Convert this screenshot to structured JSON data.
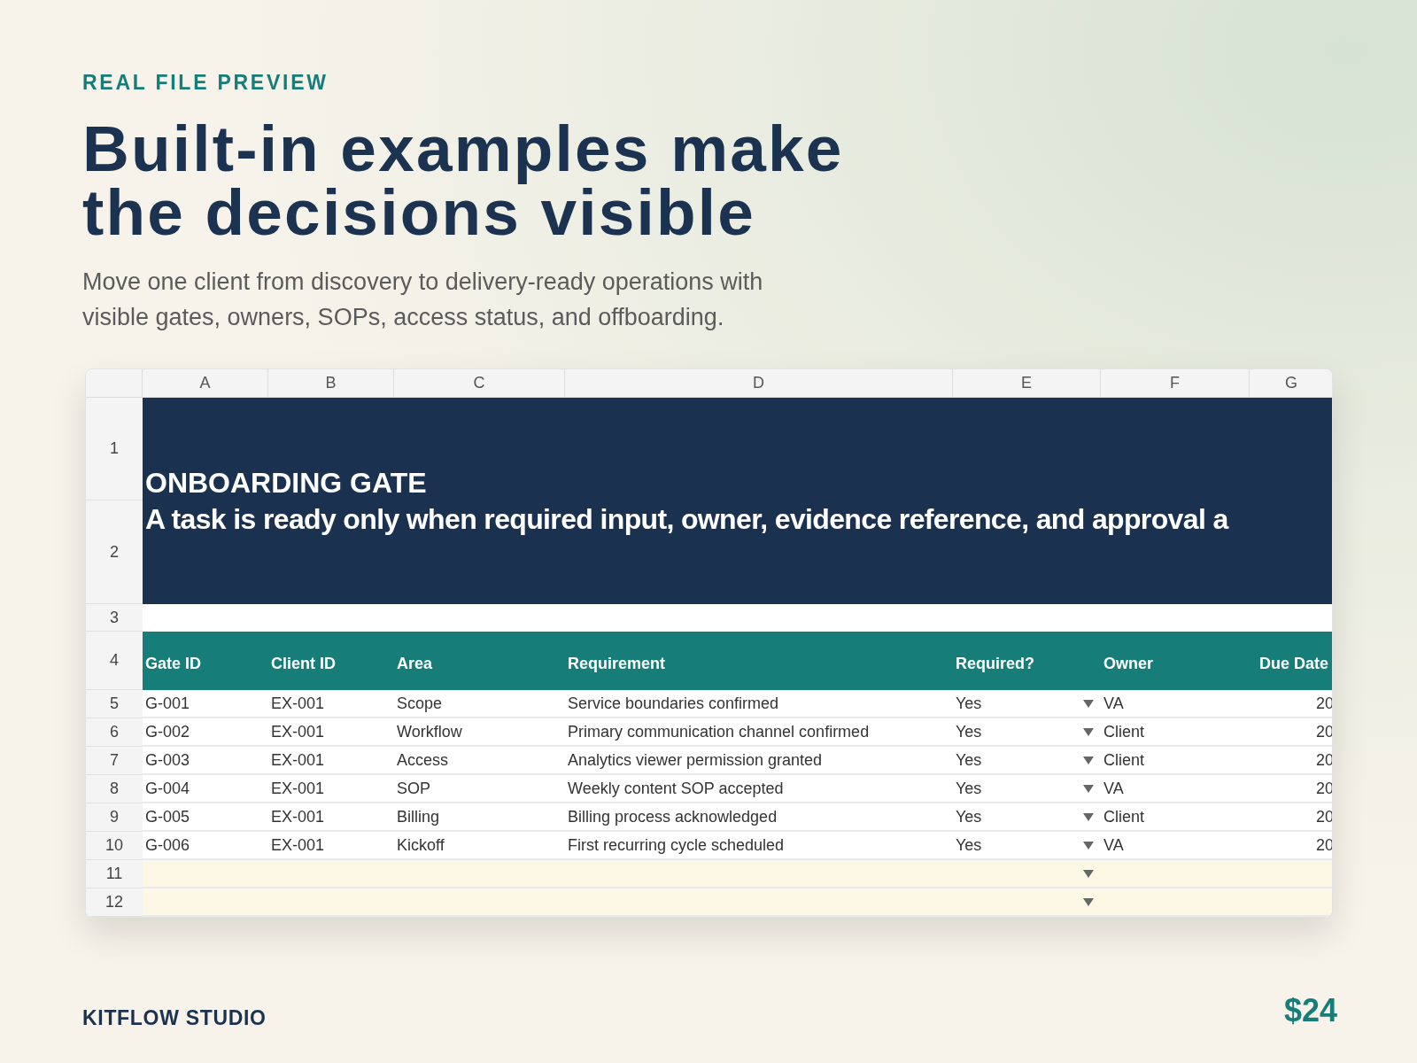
{
  "eyebrow": "REAL FILE PREVIEW",
  "headline_lines": [
    "Built-in examples make",
    "the decisions visible"
  ],
  "subtitle": "Move one client from discovery to delivery-ready operations with visible gates, owners, SOPs, access status, and offboarding.",
  "sheet": {
    "column_letters": [
      "A",
      "B",
      "C",
      "D",
      "E",
      "F",
      "G"
    ],
    "banner_title": "ONBOARDING GATE",
    "banner_subtitle": "A task is ready only when required input, owner, evidence reference, and approval a",
    "columns": [
      "Gate ID",
      "Client ID",
      "Area",
      "Requirement",
      "Required?",
      "Owner",
      "Due Date"
    ],
    "rows": [
      {
        "number": "1",
        "kind": "banner"
      },
      {
        "number": "2",
        "kind": "banner"
      },
      {
        "number": "3",
        "kind": "spacer"
      },
      {
        "number": "4",
        "kind": "header"
      },
      {
        "number": "5",
        "kind": "data",
        "cells": [
          "G-001",
          "EX-001",
          "Scope",
          "Service boundaries confirmed",
          "Yes",
          "VA",
          "20"
        ],
        "dropdown": true
      },
      {
        "number": "6",
        "kind": "data",
        "cells": [
          "G-002",
          "EX-001",
          "Workflow",
          "Primary communication channel confirmed",
          "Yes",
          "Client",
          "20"
        ],
        "dropdown": true
      },
      {
        "number": "7",
        "kind": "data",
        "cells": [
          "G-003",
          "EX-001",
          "Access",
          "Analytics viewer permission granted",
          "Yes",
          "Client",
          "20"
        ],
        "dropdown": true
      },
      {
        "number": "8",
        "kind": "data",
        "cells": [
          "G-004",
          "EX-001",
          "SOP",
          "Weekly content SOP accepted",
          "Yes",
          "VA",
          "20"
        ],
        "dropdown": true
      },
      {
        "number": "9",
        "kind": "data",
        "cells": [
          "G-005",
          "EX-001",
          "Billing",
          "Billing process acknowledged",
          "Yes",
          "Client",
          "20"
        ],
        "dropdown": true
      },
      {
        "number": "10",
        "kind": "data",
        "cells": [
          "G-006",
          "EX-001",
          "Kickoff",
          "First recurring cycle scheduled",
          "Yes",
          "VA",
          "20"
        ],
        "dropdown": true
      },
      {
        "number": "11",
        "kind": "blank",
        "dropdown": true
      },
      {
        "number": "12",
        "kind": "blank",
        "dropdown": true
      }
    ]
  },
  "footer": {
    "brand": "KITFLOW STUDIO",
    "price": "$24"
  }
}
